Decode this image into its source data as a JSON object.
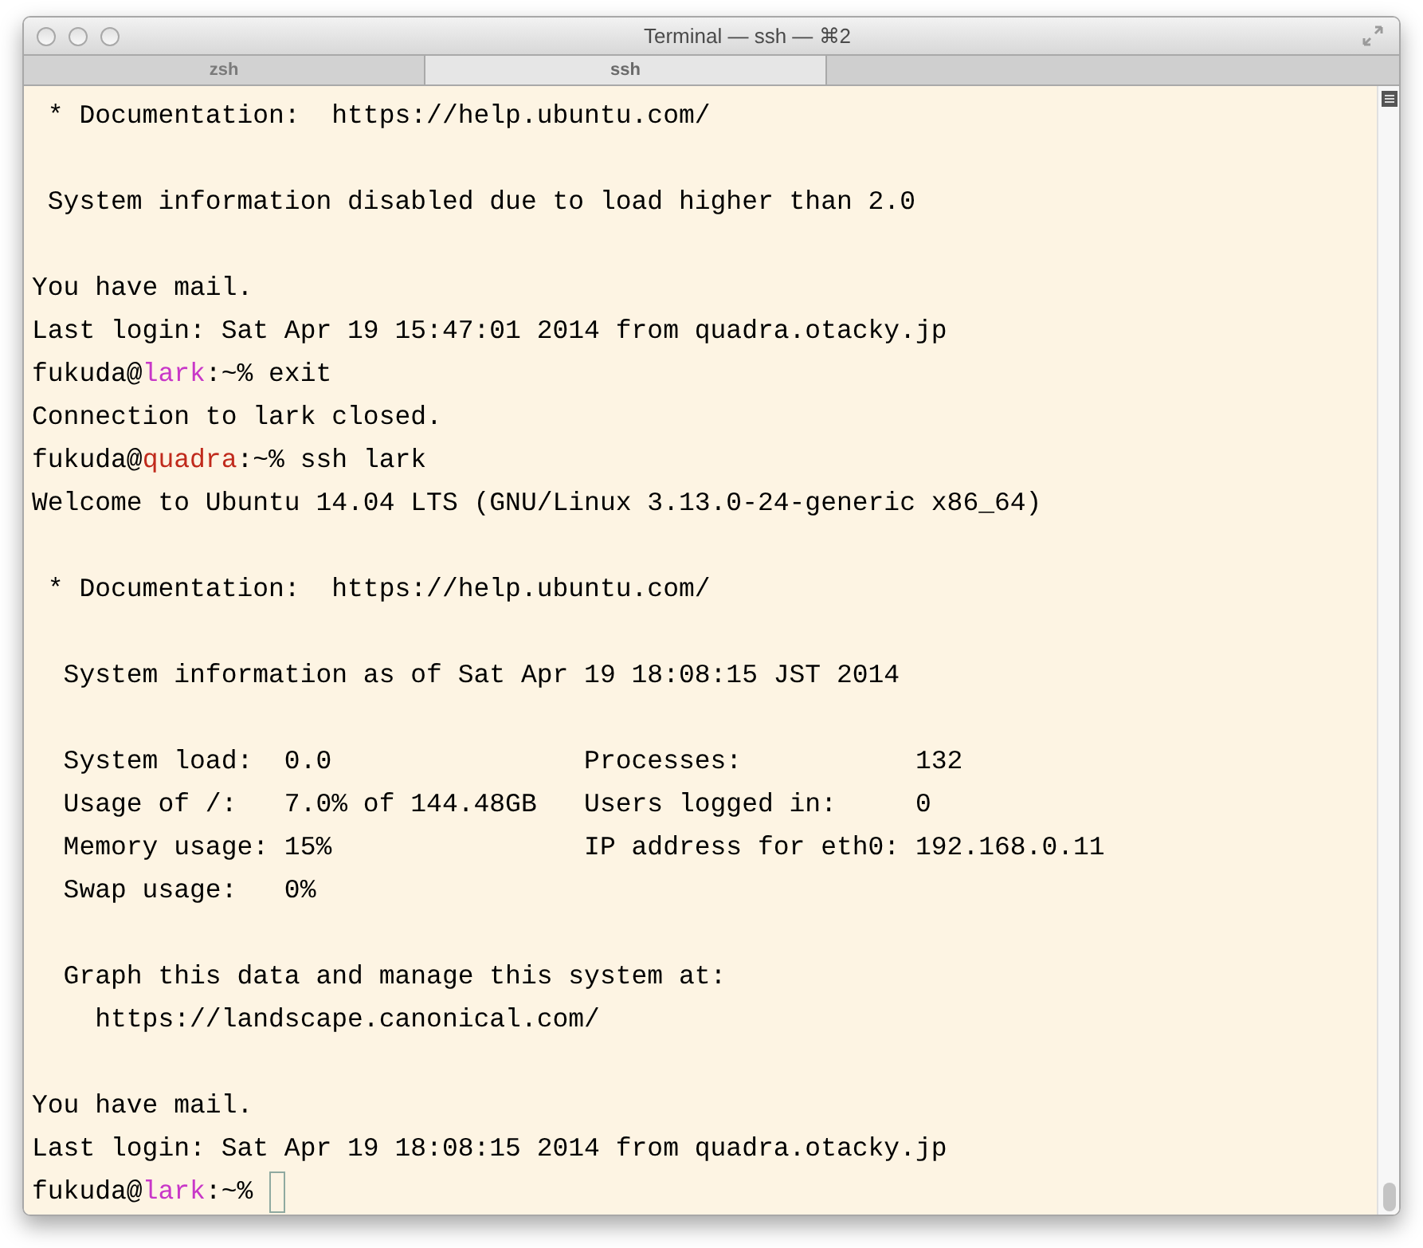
{
  "window": {
    "title": "Terminal — ssh — ⌘2"
  },
  "tabs": [
    {
      "label": "zsh",
      "selected": false
    },
    {
      "label": "ssh",
      "selected": true
    }
  ],
  "terminal": {
    "lines": [
      {
        "kind": "text",
        "text": " * Documentation:  https://help.ubuntu.com/"
      },
      {
        "kind": "blank"
      },
      {
        "kind": "text",
        "text": " System information disabled due to load higher than 2.0"
      },
      {
        "kind": "blank"
      },
      {
        "kind": "text",
        "text": "You have mail."
      },
      {
        "kind": "text",
        "text": "Last login: Sat Apr 19 15:47:01 2014 from quadra.otacky.jp"
      },
      {
        "kind": "prompt",
        "user": "fukuda@",
        "host": "lark",
        "color": "#c837c8",
        "rest": ":~% exit",
        "cursor": false
      },
      {
        "kind": "text",
        "text": "Connection to lark closed."
      },
      {
        "kind": "prompt",
        "user": "fukuda@",
        "host": "quadra",
        "color": "#c02a1c",
        "rest": ":~% ssh lark",
        "cursor": false
      },
      {
        "kind": "text",
        "text": "Welcome to Ubuntu 14.04 LTS (GNU/Linux 3.13.0-24-generic x86_64)"
      },
      {
        "kind": "blank"
      },
      {
        "kind": "text",
        "text": " * Documentation:  https://help.ubuntu.com/"
      },
      {
        "kind": "blank"
      },
      {
        "kind": "text",
        "text": "  System information as of Sat Apr 19 18:08:15 JST 2014"
      },
      {
        "kind": "blank"
      },
      {
        "kind": "text",
        "text": "  System load:  0.0                Processes:           132"
      },
      {
        "kind": "text",
        "text": "  Usage of /:   7.0% of 144.48GB   Users logged in:     0"
      },
      {
        "kind": "text",
        "text": "  Memory usage: 15%                IP address for eth0: 192.168.0.11"
      },
      {
        "kind": "text",
        "text": "  Swap usage:   0%"
      },
      {
        "kind": "blank"
      },
      {
        "kind": "text",
        "text": "  Graph this data and manage this system at:"
      },
      {
        "kind": "text",
        "text": "    https://landscape.canonical.com/"
      },
      {
        "kind": "blank"
      },
      {
        "kind": "text",
        "text": "You have mail."
      },
      {
        "kind": "text",
        "text": "Last login: Sat Apr 19 18:08:15 2014 from quadra.otacky.jp"
      },
      {
        "kind": "prompt",
        "user": "fukuda@",
        "host": "lark",
        "color": "#c837c8",
        "rest": ":~% ",
        "cursor": true
      }
    ]
  }
}
